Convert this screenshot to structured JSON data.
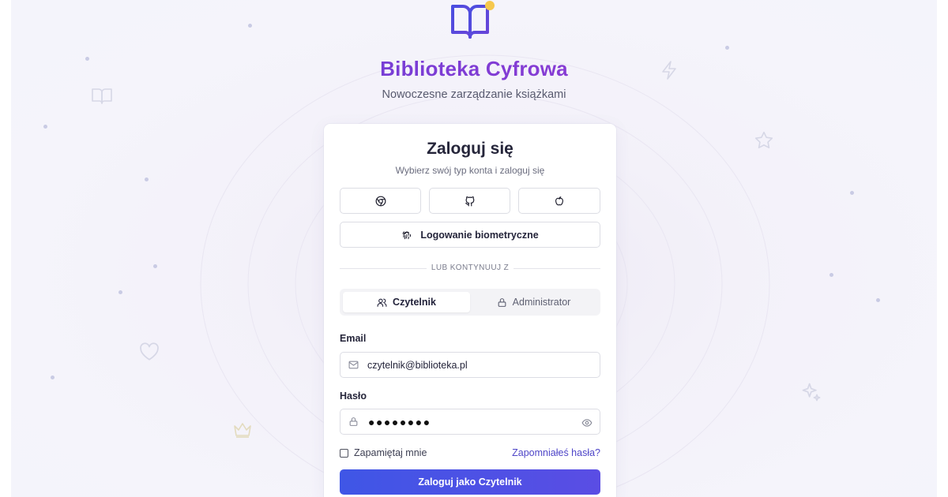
{
  "brand": {
    "title": "Biblioteka Cyfrowa",
    "subtitle": "Nowoczesne zarządzanie książkami",
    "gradient_start": "#5b3fd9",
    "gradient_end": "#a43ad0"
  },
  "login": {
    "title": "Zaloguj się",
    "subtitle": "Wybierz swój typ konta i zaloguj się",
    "social_buttons": [
      {
        "icon": "chrome-icon"
      },
      {
        "icon": "github-icon"
      },
      {
        "icon": "apple-icon"
      }
    ],
    "biometric_label": "Logowanie biometryczne",
    "divider_text": "LUB KONTYNUUJ Z",
    "tabs": [
      {
        "label": "Czytelnik",
        "icon": "users-icon",
        "active": true
      },
      {
        "label": "Administrator",
        "icon": "lock-icon",
        "active": false
      }
    ],
    "email_label": "Email",
    "email_value": "czytelnik@biblioteka.pl",
    "password_label": "Hasło",
    "password_value": "●●●●●●●●",
    "remember_label": "Zapamiętaj mnie",
    "forgot_label": "Zapomniałeś hasła?",
    "submit_label": "Zaloguj jako Czytelnik",
    "accent_color": "#4f46c8"
  }
}
